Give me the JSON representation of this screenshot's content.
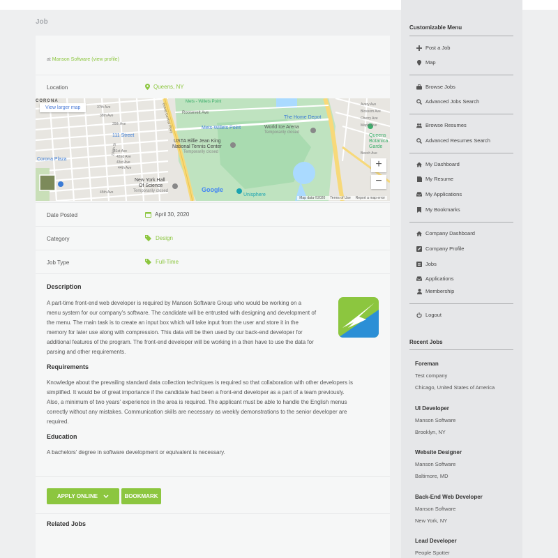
{
  "page_title": "Job",
  "job": {
    "at_prefix": "at ",
    "company": "Manson Software",
    "view_profile": "(view profile)",
    "location_label": "Location",
    "location_value": "Queens, NY",
    "date_label": "Date Posted",
    "date_value": "April 30, 2020",
    "category_label": "Category",
    "category_value": "Design",
    "type_label": "Job Type",
    "type_value": "Full-Time"
  },
  "map": {
    "view_larger": "View larger map",
    "zoom_in": "+",
    "zoom_out": "−",
    "map_data": "Map data ©2020",
    "terms": "Terms of Use",
    "report": "Report a map error",
    "google": "Google",
    "labels": {
      "corona": "CORONA",
      "corona_plaza": "Corona Plaza",
      "st111": "111 Street",
      "mets_willets": "Mets - Willets Point",
      "roosevelt": "Roosevelt Ave",
      "home_depot": "The Home Depot",
      "mets_point": "Mets-Willets Point",
      "world_ice": "World Ice Arena",
      "temp_closed": "Temporarily closed",
      "usta": "USTA Billie Jean King",
      "national_tennis": "National Tennis Center",
      "temp_closed2": "Temporarily closed",
      "nyhall": "New York Hall",
      "of_science": "Of Science",
      "temp_closed3": "Temporarily closed",
      "unisphere": "Unisphere",
      "queens_bot": "Queens",
      "botanical": "Botanica",
      "garden": "Garde",
      "st37": "37th Ave",
      "st38": "38th Ave",
      "st39": "39th Ave",
      "st41": "41st Ave",
      "st42": "42nd Ave",
      "st43": "43rd Ave",
      "st44": "44th Ave",
      "st45": "45th Ave",
      "central_pkwy": "Grand Central Pkwy",
      "ave108": "108th St",
      "ave_r1": "Avery Ave",
      "ave_r2": "Blossom Ave",
      "ave_r3": "Cherry Ave",
      "ave_r4": "Maple Ave",
      "ave_r5": "Beech Ave"
    }
  },
  "description": {
    "title": "Description",
    "lines": [
      "A part-time front-end web developer is required by Manson Software Group who would be working on a",
      "menu system for our company's software. The candidate will be entrusted with designing and development of",
      "the menu. The main task is to create an input box which will take input from the user and store it in the",
      "memory for later use along with compression. This data will be then used by our back-end developer for",
      "additional features of the program. The front-end developer will be working in a then have to use the data for",
      "parsing and other requirements."
    ],
    "req_title": "Requirements",
    "req_lines": [
      "Knowledge about the prevailing standard data collection techniques is required so that collaboration with other developers is",
      "simplified. It would be of great importance if the candidate had been a front-end developer as a part of a team previously.",
      "Also, a minimum of two years' experience in the area is required. The applicant must be able to handle the English menus",
      "correctly without any mistakes. Communication skills are necessary as weekly demonstrations to the senior developer are",
      "required."
    ],
    "edu_title": "Education",
    "edu_text": "A bachelors' degree in software development or equivalent is necessary."
  },
  "actions": {
    "apply": "APPLY ONLINE",
    "bookmark": "BOOKMARK"
  },
  "related_title": "Related Jobs",
  "sidebar": {
    "menu_title": "Customizable Menu",
    "groups": [
      [
        {
          "label": "Post a Job",
          "icon": "plus-icon"
        },
        {
          "label": "Map",
          "icon": "map-pin-icon"
        }
      ],
      [
        {
          "label": "Browse Jobs",
          "icon": "briefcase-icon"
        },
        {
          "label": "Advanced Jobs Search",
          "icon": "search-icon"
        }
      ],
      [
        {
          "label": "Browse Resumes",
          "icon": "users-icon"
        },
        {
          "label": "Advanced Resumes Search",
          "icon": "search-icon"
        }
      ],
      [
        {
          "label": "My Dashboard",
          "icon": "home-icon"
        },
        {
          "label": "My Resume",
          "icon": "file-icon"
        },
        {
          "label": "My Applications",
          "icon": "inbox-icon"
        },
        {
          "label": "My Bookmarks",
          "icon": "bookmark-icon"
        }
      ],
      [
        {
          "label": "Company Dashboard",
          "icon": "home-icon"
        },
        {
          "label": "Company Profile",
          "icon": "edit-icon"
        },
        {
          "label": "Jobs",
          "icon": "list-icon"
        },
        {
          "label": "Applications",
          "icon": "inbox-icon"
        },
        {
          "label": "Membership",
          "icon": "user-icon"
        }
      ],
      [
        {
          "label": "Logout",
          "icon": "power-icon"
        }
      ]
    ],
    "recent_title": "Recent Jobs",
    "recent": [
      {
        "title": "Foreman",
        "company": "Test company",
        "location": "Chicago, United States of America"
      },
      {
        "title": "UI Developer",
        "company": "Manson Software",
        "location": "Brooklyn, NY"
      },
      {
        "title": "Website Designer",
        "company": "Manson Software",
        "location": "Baltimore, MD"
      },
      {
        "title": "Back-End Web Developer",
        "company": "Manson Software",
        "location": "New York, NY"
      },
      {
        "title": "Lead Developer",
        "company": "People Spotter",
        "location": ""
      }
    ]
  },
  "colors": {
    "accent": "#8cc63f",
    "background": "#eeeff0",
    "card": "#f6f7f7",
    "sidebar": "#e6e7e9"
  }
}
